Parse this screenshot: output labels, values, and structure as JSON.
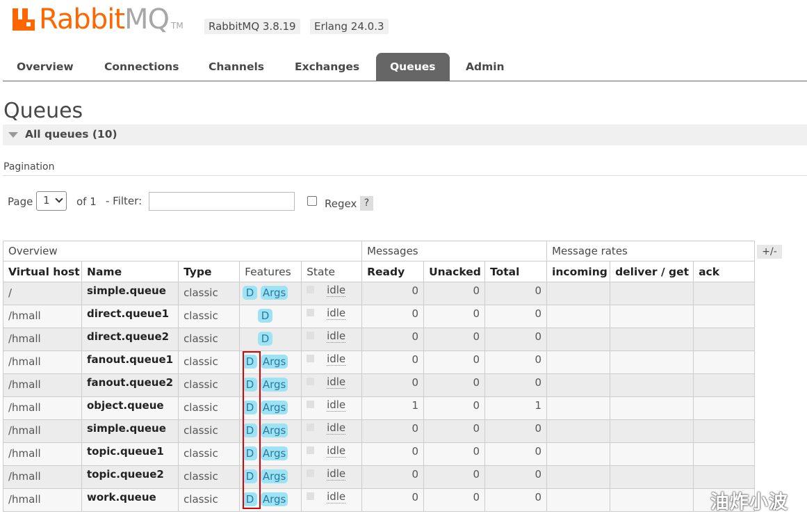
{
  "header": {
    "logo_rabbit": "Rabbit",
    "logo_mq": "MQ",
    "logo_tm": "TM",
    "rabbitmq_version": "RabbitMQ 3.8.19",
    "erlang_version": "Erlang 24.0.3"
  },
  "tabs": [
    {
      "label": "Overview",
      "active": false
    },
    {
      "label": "Connections",
      "active": false
    },
    {
      "label": "Channels",
      "active": false
    },
    {
      "label": "Exchanges",
      "active": false
    },
    {
      "label": "Queues",
      "active": true
    },
    {
      "label": "Admin",
      "active": false
    }
  ],
  "page_title": "Queues",
  "section": {
    "title": "All queues (10)"
  },
  "pagination": {
    "label": "Pagination",
    "page_label": "Page",
    "page_value": "1",
    "of_label": "of 1",
    "filter_label": "- Filter:",
    "filter_value": "",
    "regex_label": "Regex",
    "regex_checked": false,
    "help_label": "?"
  },
  "table": {
    "groups": [
      "Overview",
      "Messages",
      "Message rates"
    ],
    "columns": [
      "Virtual host",
      "Name",
      "Type",
      "Features",
      "State",
      "Ready",
      "Unacked",
      "Total",
      "incoming",
      "deliver / get",
      "ack"
    ],
    "toggle_label": "+/-",
    "rows": [
      {
        "vhost": "/",
        "name": "simple.queue",
        "type": "classic",
        "d": "D",
        "args": "Args",
        "state": "idle",
        "ready": "0",
        "unacked": "0",
        "total": "0"
      },
      {
        "vhost": "/hmall",
        "name": "direct.queue1",
        "type": "classic",
        "d": "D",
        "args": "",
        "state": "idle",
        "ready": "0",
        "unacked": "0",
        "total": "0"
      },
      {
        "vhost": "/hmall",
        "name": "direct.queue2",
        "type": "classic",
        "d": "D",
        "args": "",
        "state": "idle",
        "ready": "0",
        "unacked": "0",
        "total": "0"
      },
      {
        "vhost": "/hmall",
        "name": "fanout.queue1",
        "type": "classic",
        "d": "D",
        "args": "Args",
        "state": "idle",
        "ready": "0",
        "unacked": "0",
        "total": "0"
      },
      {
        "vhost": "/hmall",
        "name": "fanout.queue2",
        "type": "classic",
        "d": "D",
        "args": "Args",
        "state": "idle",
        "ready": "0",
        "unacked": "0",
        "total": "0"
      },
      {
        "vhost": "/hmall",
        "name": "object.queue",
        "type": "classic",
        "d": "D",
        "args": "Args",
        "state": "idle",
        "ready": "1",
        "unacked": "0",
        "total": "1"
      },
      {
        "vhost": "/hmall",
        "name": "simple.queue",
        "type": "classic",
        "d": "D",
        "args": "Args",
        "state": "idle",
        "ready": "0",
        "unacked": "0",
        "total": "0"
      },
      {
        "vhost": "/hmall",
        "name": "topic.queue1",
        "type": "classic",
        "d": "D",
        "args": "Args",
        "state": "idle",
        "ready": "0",
        "unacked": "0",
        "total": "0"
      },
      {
        "vhost": "/hmall",
        "name": "topic.queue2",
        "type": "classic",
        "d": "D",
        "args": "Args",
        "state": "idle",
        "ready": "0",
        "unacked": "0",
        "total": "0"
      },
      {
        "vhost": "/hmall",
        "name": "work.queue",
        "type": "classic",
        "d": "D",
        "args": "Args",
        "state": "idle",
        "ready": "0",
        "unacked": "0",
        "total": "0"
      }
    ]
  },
  "watermark": "油炸小波",
  "colors": {
    "brand": "#ff6600",
    "tab_active": "#666666",
    "badge": "#9ee3f4",
    "highlight": "#dd0000"
  }
}
